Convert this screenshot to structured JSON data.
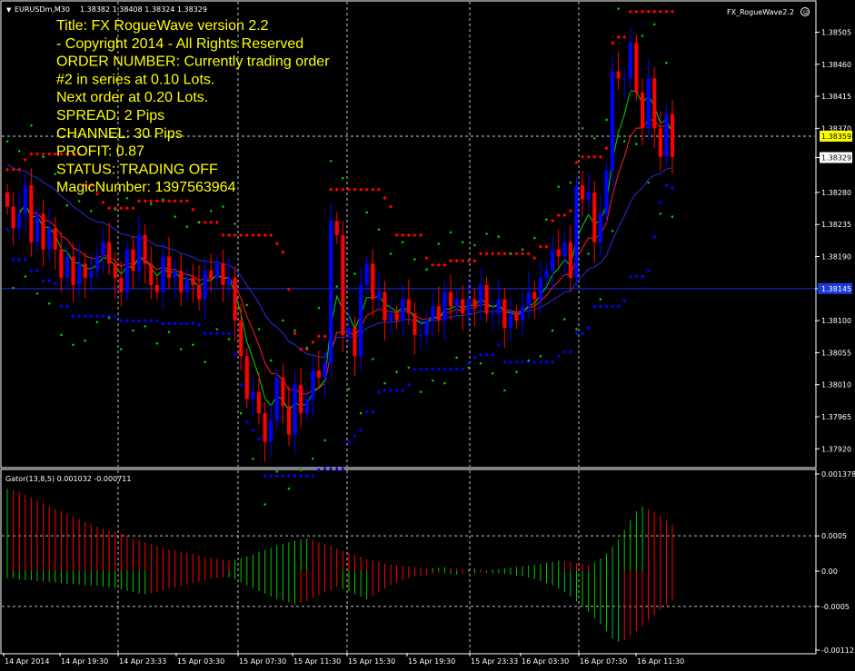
{
  "symbol": {
    "title": "EURUSDm,M30",
    "ohlc": "1.38382 1.38408 1.38324 1.38329",
    "expert": "FX_RogueWave2.2"
  },
  "overlay_lines": [
    "Title: FX RogueWave version 2.2",
    "      - Copyright 2014 - All Rights Reserved",
    "ORDER NUMBER: Currently trading order",
    "#2 in series at 0.10 Lots.",
    "Next order at 0.20 Lots.",
    "SPREAD:  2 Pips",
    "CHANNEL: 30 Pips",
    "PROFIT:  0.87",
    "STATUS:  TRADING OFF",
    "MagicNumber:  1397563964"
  ],
  "gator": {
    "title": "Gator(13,8,5) 0.001032 -0.000711",
    "ticks": [
      "0.001378",
      "0.0005",
      "0.00",
      "-0.0005",
      "-0.00112"
    ]
  },
  "colors": {
    "background": "#000000",
    "bull": "#0000FF",
    "bear": "#FF0000",
    "fast_ma": "#00C800",
    "mid_ma": "#E02020",
    "slow_ma": "#2828C8",
    "text": "#FFFF00",
    "sar": "#00C800",
    "grid": "#FFFFFF"
  },
  "chart_data": [
    {
      "type": "candlestick",
      "price_ticks": [
        "1.38505",
        "1.38460",
        "1.38415",
        "1.38370",
        "1.38329",
        "1.38280",
        "1.38235",
        "1.38190",
        "1.38145",
        "1.38100",
        "1.38055",
        "1.38010",
        "1.37965",
        "1.37920"
      ],
      "current_price": "1.38359",
      "bid_price": "1.38329",
      "horizontal_line_label": "1.38145",
      "time_ticks": [
        "14 Apr 2014",
        "14 Apr 19:30",
        "14 Apr 23:33",
        "15 Apr 03:30",
        "15 Apr 07:30",
        "15 Apr 11:30",
        "15 Apr 15:30",
        "15 Apr 19:30",
        "15 Apr 23:33",
        "16 Apr 03:30",
        "16 Apr 07:30",
        "16 Apr 11:30"
      ],
      "ylim": [
        1.379,
        1.3854
      ],
      "close": [
        1.3826,
        1.3823,
        1.3825,
        1.3829,
        1.3821,
        1.3825,
        1.382,
        1.3823,
        1.382,
        1.3816,
        1.3819,
        1.3815,
        1.3818,
        1.3816,
        1.3817,
        1.3819,
        1.3821,
        1.3818,
        1.3816,
        1.3814,
        1.382,
        1.3817,
        1.3822,
        1.3818,
        1.3815,
        1.3814,
        1.3819,
        1.3816,
        1.3817,
        1.3814,
        1.3816,
        1.3815,
        1.3813,
        1.3817,
        1.3816,
        1.3818,
        1.3815,
        1.3816,
        1.381,
        1.3805,
        1.3799,
        1.38,
        1.3797,
        1.3793,
        1.3796,
        1.3802,
        1.3798,
        1.3794,
        1.3801,
        1.3797,
        1.3799,
        1.3803,
        1.3802,
        1.3804,
        1.3824,
        1.3822,
        1.3808,
        1.3809,
        1.3805,
        1.3815,
        1.3818,
        1.3813,
        1.3814,
        1.381,
        1.3811,
        1.381,
        1.3813,
        1.3811,
        1.3808,
        1.3808,
        1.381,
        1.3812,
        1.381,
        1.3814,
        1.3812,
        1.3813,
        1.3811,
        1.3813,
        1.3812,
        1.3815,
        1.3811,
        1.3811,
        1.3813,
        1.3809,
        1.3811,
        1.381,
        1.3812,
        1.3814,
        1.3813,
        1.3816,
        1.3817,
        1.382,
        1.3819,
        1.3821,
        1.3816,
        1.3829,
        1.3827,
        1.3828,
        1.3821,
        1.3825,
        1.3831,
        1.3845,
        1.3844,
        1.3844,
        1.3849,
        1.3842,
        1.3837,
        1.3844,
        1.3837,
        1.3833,
        1.3839,
        1.3833
      ],
      "sar_dots": "green above/below price",
      "series": [
        {
          "name": "FX_RogueWave2.2 channel high",
          "color": "#FF0000"
        },
        {
          "name": "FX_RogueWave2.2 channel low",
          "color": "#0000FF"
        }
      ]
    },
    {
      "type": "bar",
      "title": "Gator(13,8,5) 0.001032 -0.000711",
      "ylim": [
        -0.00112,
        0.001378
      ],
      "upper": [
        0.00117,
        0.00115,
        0.00112,
        0.00108,
        0.00104,
        0.001,
        0.00096,
        0.00092,
        0.00088,
        0.00085,
        0.00082,
        0.00078,
        0.00074,
        0.0007,
        0.00066,
        0.00063,
        0.0006,
        0.00058,
        0.00056,
        0.00054,
        0.0005,
        0.00046,
        0.00044,
        0.00041,
        0.00038,
        0.00035,
        0.00033,
        0.00031,
        0.0003,
        0.00028,
        0.00026,
        0.00024,
        0.00022,
        0.0002,
        0.00019,
        0.00017,
        0.00016,
        0.00015,
        0.00016,
        0.00018,
        0.00021,
        0.00024,
        0.00027,
        0.0003,
        0.00033,
        0.00036,
        0.00039,
        0.00041,
        0.00043,
        0.00045,
        0.00046,
        0.00044,
        0.00041,
        0.00038,
        0.00035,
        0.00032,
        0.00029,
        0.00026,
        0.00023,
        0.0002,
        0.00017,
        0.00015,
        0.00013,
        0.00011,
        0.0001,
        9e-05,
        8e-05,
        7e-05,
        6e-05,
        5e-05,
        4e-05,
        4e-05,
        5e-05,
        6e-05,
        5e-05,
        4e-05,
        3e-05,
        3e-05,
        4e-05,
        3e-05,
        2e-05,
        2e-05,
        3e-05,
        4e-05,
        5e-05,
        6e-05,
        7e-05,
        8e-05,
        9e-05,
        0.0001,
        0.00012,
        0.00013,
        0.00015,
        0.00014,
        0.00013,
        0.00011,
        0.0001,
        9e-05,
        0.00012,
        0.00018,
        0.00025,
        0.00035,
        0.00045,
        0.00058,
        0.00072,
        0.00085,
        0.00092,
        0.00088,
        0.00084,
        0.00078,
        0.00072,
        0.00066
      ],
      "lower": [
        -0.0001,
        -0.0001,
        -0.00012,
        -0.00013,
        -0.00013,
        -0.00014,
        -0.00015,
        -0.00015,
        -0.00016,
        -0.00017,
        -0.00018,
        -0.00018,
        -0.00019,
        -0.0002,
        -0.00021,
        -0.00021,
        -0.00022,
        -0.00023,
        -0.00024,
        -0.00026,
        -0.00028,
        -0.0003,
        -0.00032,
        -0.00033,
        -0.00031,
        -0.00029,
        -0.00027,
        -0.00025,
        -0.00023,
        -0.00021,
        -0.00019,
        -0.00017,
        -0.00015,
        -0.00013,
        -0.00011,
        -0.0001,
        -9e-05,
        -9e-05,
        -0.00012,
        -0.00016,
        -0.0002,
        -0.00024,
        -0.00028,
        -0.00032,
        -0.00036,
        -0.0004,
        -0.00042,
        -0.00044,
        -0.00046,
        -0.00045,
        -0.00042,
        -0.00038,
        -0.00034,
        -0.0003,
        -0.00026,
        -0.00022,
        -0.00025,
        -0.00029,
        -0.00033,
        -0.00036,
        -0.0004,
        -0.00035,
        -0.0003,
        -0.00025,
        -0.0002,
        -0.00016,
        -0.00013,
        -0.0001,
        -8e-05,
        -6e-05,
        -5e-05,
        -4e-05,
        -3e-05,
        -3e-05,
        -4e-05,
        -5e-05,
        -4e-05,
        -3e-05,
        -3e-05,
        -2e-05,
        -2e-05,
        -3e-05,
        -3e-05,
        -4e-05,
        -5e-05,
        -6e-05,
        -7e-05,
        -9e-05,
        -0.00011,
        -0.00014,
        -0.00017,
        -0.0002,
        -0.00025,
        -0.0003,
        -0.00036,
        -0.00043,
        -0.0005,
        -0.00058,
        -0.00067,
        -0.00075,
        -0.00085,
        -0.00095,
        -0.001,
        -0.00098,
        -0.00092,
        -0.00085,
        -0.00078,
        -0.0007,
        -0.00062,
        -0.00055,
        -0.00048,
        -0.00042
      ]
    }
  ]
}
